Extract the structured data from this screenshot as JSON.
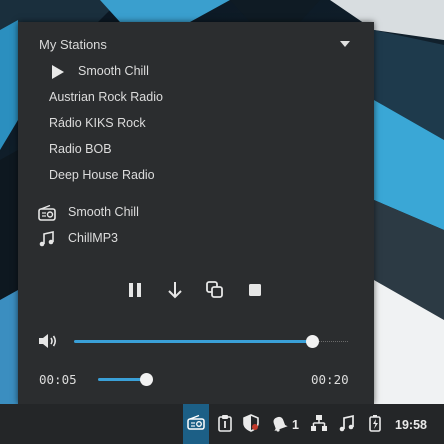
{
  "panel": {
    "header": "My Stations",
    "stations": [
      {
        "label": "Smooth Chill",
        "playing": true
      },
      {
        "label": "Austrian Rock Radio",
        "playing": false
      },
      {
        "label": "Rádio KIKS Rock",
        "playing": false
      },
      {
        "label": "Radio BOB",
        "playing": false
      },
      {
        "label": "Deep House Radio",
        "playing": false
      }
    ],
    "now_playing": {
      "station": "Smooth Chill",
      "track": "ChillMP3",
      "station_icon": "radio-icon",
      "track_icon": "music-note-icon"
    },
    "controls": [
      "pause-icon",
      "download-icon",
      "copy-icon",
      "stop-icon"
    ],
    "volume": {
      "level": 0.87
    },
    "progress": {
      "elapsed": "00:05",
      "total": "00:20",
      "fraction": 0.25
    }
  },
  "taskbar": {
    "tray_icons": [
      "radio-tray-icon",
      "clipboard-icon",
      "shield-icon",
      "notification-bell-icon",
      "network-icon",
      "music-tray-icon",
      "battery-icon"
    ],
    "notification_count": "1",
    "clock": "19:58"
  },
  "colors": {
    "accent": "#3aa0d8",
    "panel_bg": "#2b2d2f",
    "taskbar_bg": "#242628"
  }
}
